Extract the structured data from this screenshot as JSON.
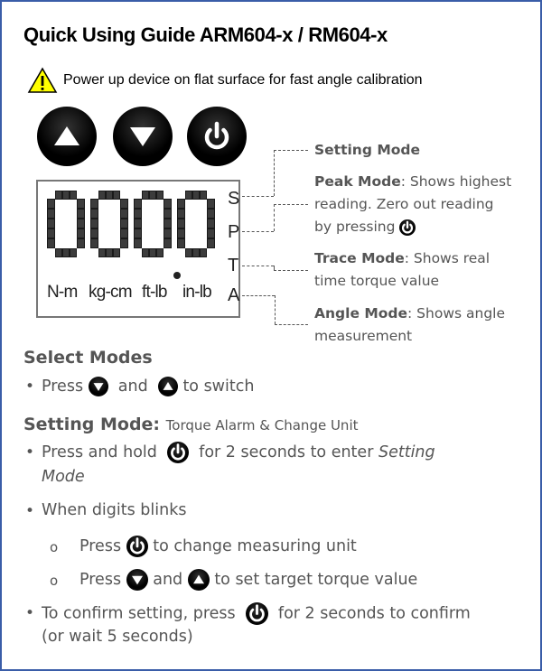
{
  "title": "Quick Using Guide ARM604-x / RM604-x",
  "warning": {
    "icon": "warning-triangle-icon",
    "text": "Power up device on flat surface for fast angle calibration"
  },
  "buttons": [
    {
      "name": "up-button",
      "icon": "triangle-up-icon"
    },
    {
      "name": "down-button",
      "icon": "triangle-down-icon"
    },
    {
      "name": "power-button",
      "icon": "power-icon"
    }
  ],
  "lcd": {
    "reading": "000.0",
    "mode_letters": [
      "S",
      "P",
      "T",
      "A"
    ],
    "units": [
      "N-m",
      "kg-cm",
      "ft-lb",
      "in-lb"
    ]
  },
  "modes": {
    "setting": {
      "title": "Setting Mode"
    },
    "peak": {
      "title": "Peak Mode",
      "text1": ": Shows highest",
      "text2": "reading. Zero out reading",
      "text3": "by pressing"
    },
    "trace": {
      "title": "Trace Mode",
      "text1": ": Shows real",
      "text2": "time torque value"
    },
    "angle": {
      "title": "Angle Mode",
      "text1": ": Shows angle",
      "text2": "measurement"
    }
  },
  "select_modes": {
    "heading": "Select Modes",
    "press": "Press",
    "and": "and",
    "to_switch": "to switch"
  },
  "setting_mode": {
    "heading": "Setting Mode:",
    "subheading": "Torque Alarm & Change Unit",
    "b1_a": "Press and hold",
    "b1_b": "for 2 seconds to enter",
    "b1_c": "Setting",
    "b1_d": "Mode",
    "b2": "When digits blinks",
    "s1_a": "Press",
    "s1_b": "to change measuring unit",
    "s2_a": "Press",
    "s2_b": "and",
    "s2_c": "to set target torque value",
    "b3_a": "To confirm setting, press",
    "b3_b": "for 2 seconds to confirm",
    "b3_c": "(or wait 5 seconds)"
  },
  "bullet_char": "•",
  "sub_bullet_char": "o"
}
